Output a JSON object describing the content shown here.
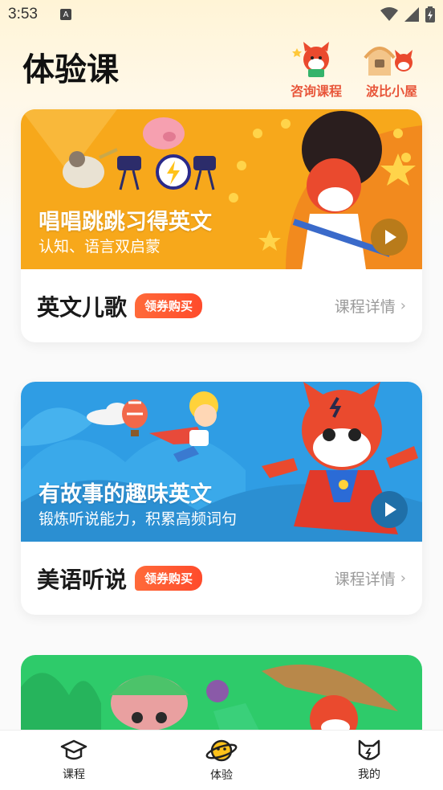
{
  "status_bar": {
    "time": "3:53",
    "notif_letter": "A"
  },
  "header": {
    "title": "体验课",
    "consult_label": "咨询课程",
    "house_label": "波比小屋"
  },
  "cards": [
    {
      "banner_title": "唱唱跳跳习得英文",
      "banner_subtitle": "认知、语言双启蒙",
      "course_name": "英文儿歌",
      "coupon_label": "领券购买",
      "detail_label": "课程详情",
      "banner_color": "#f7a81b",
      "play_color": "#b97b1a"
    },
    {
      "banner_title": "有故事的趣味英文",
      "banner_subtitle": "锻炼听说能力，积累高频词句",
      "course_name": "美语听说",
      "coupon_label": "领券购买",
      "detail_label": "课程详情",
      "banner_color": "#2f9de4",
      "play_color": "#1f6fa8"
    }
  ],
  "tabs": [
    {
      "label": "课程",
      "icon": "graduation-cap-icon"
    },
    {
      "label": "体验",
      "icon": "planet-icon"
    },
    {
      "label": "我的",
      "icon": "cat-face-icon"
    }
  ],
  "colors": {
    "accent": "#ff5a2c",
    "brand_orange": "#f7a81b",
    "brand_blue": "#2f9de4",
    "brand_green": "#2ecb6a"
  }
}
